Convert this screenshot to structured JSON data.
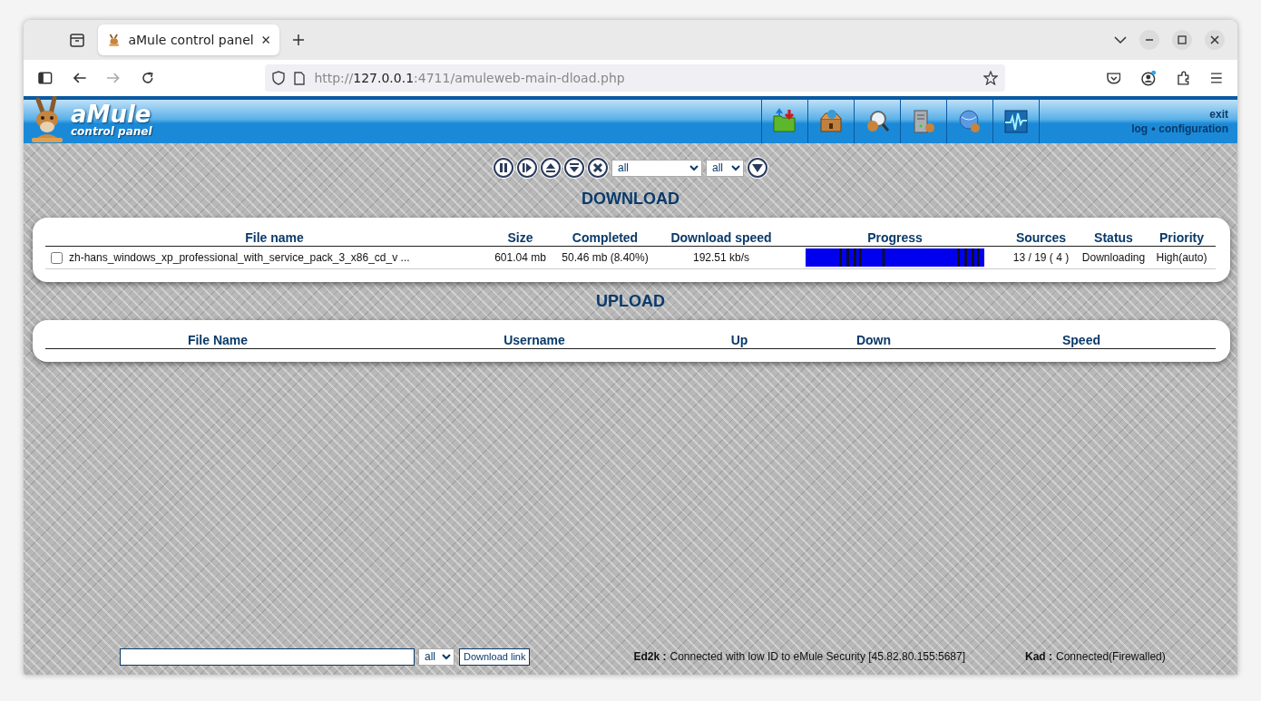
{
  "browser": {
    "tab_title": "aMule control panel",
    "url": {
      "scheme": "http://",
      "host": "127.0.0.1",
      "rest": ":4711/amuleweb-main-dload.php"
    }
  },
  "header": {
    "logo_title": "aMule",
    "logo_subtitle": "control panel",
    "exit": "exit",
    "log": "log",
    "separator": "•",
    "configuration": "configuration"
  },
  "controls": {
    "category": "all",
    "status_filter": "all"
  },
  "download": {
    "title": "DOWNLOAD",
    "columns": [
      "File name",
      "Size",
      "Completed",
      "Download speed",
      "Progress",
      "Sources",
      "Status",
      "Priority"
    ],
    "rows": [
      {
        "checked": false,
        "file_name": "zh-hans_windows_xp_professional_with_service_pack_3_x86_cd_v ...",
        "size": "601.04 mb",
        "completed": "50.46 mb (8.40%)",
        "speed": "192.51 kb/s",
        "sources": "13 / 19 ( 4 )",
        "status": "Downloading",
        "priority": "High(auto)"
      }
    ]
  },
  "upload": {
    "title": "UPLOAD",
    "columns": [
      "File Name",
      "Username",
      "Up",
      "Down",
      "Speed"
    ]
  },
  "footer": {
    "link_category": "all",
    "download_button": "Download link",
    "ed2k_label": "Ed2k :",
    "ed2k_status": "Connected with low ID to eMule Security [45.82.80.155:5687]",
    "kad_label": "Kad :",
    "kad_status": "Connected(Firewalled)"
  }
}
